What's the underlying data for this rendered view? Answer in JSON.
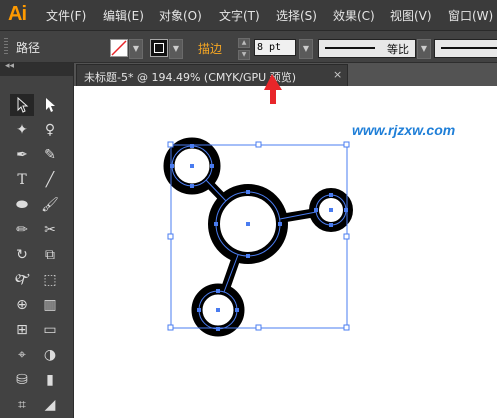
{
  "app": {
    "logo": "Ai"
  },
  "menu": [
    {
      "label": "文件(F)"
    },
    {
      "label": "编辑(E)"
    },
    {
      "label": "对象(O)"
    },
    {
      "label": "文字(T)"
    },
    {
      "label": "选择(S)"
    },
    {
      "label": "效果(C)"
    },
    {
      "label": "视图(V)"
    },
    {
      "label": "窗口(W)"
    }
  ],
  "control_bar": {
    "object_label": "路径",
    "stroke_label": "描边",
    "stroke_weight": "8 pt",
    "profile_label": "等比"
  },
  "document_tab": {
    "title": "未标题-5* @ 194.49% (CMYK/GPU 预览)",
    "close": "×"
  },
  "watermark": "www.rjzxw.com",
  "colors": {
    "accent": "#f5a623",
    "selection": "#4a7cf0",
    "arrow": "#e8262a",
    "shape": "#000000"
  }
}
